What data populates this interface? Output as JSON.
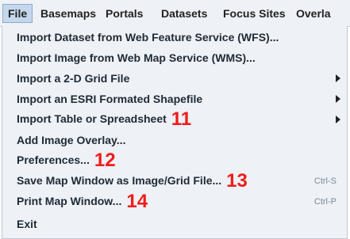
{
  "menubar": {
    "items": [
      {
        "label": "File",
        "active": true
      },
      {
        "label": "Basemaps"
      },
      {
        "label": "Portals"
      },
      {
        "label": "Datasets"
      },
      {
        "label": "Focus Sites"
      },
      {
        "label": "Overla"
      }
    ]
  },
  "file_menu": {
    "items": [
      {
        "label": "Import Dataset from Web Feature Service (WFS)..."
      },
      {
        "label": "Import Image from Web Map Service (WMS)..."
      },
      {
        "label": "Import a 2-D Grid File",
        "submenu": true
      },
      {
        "label": "Import an ESRI Formated Shapefile",
        "submenu": true
      },
      {
        "label": "Import Table or Spreadsheet",
        "submenu": true,
        "annotation": "11"
      },
      {
        "label": "Add Image Overlay..."
      },
      {
        "label": "Preferences...",
        "annotation": "12"
      },
      {
        "label": "Save Map Window as Image/Grid File...",
        "annotation": "13",
        "accelerator": "Ctrl-S"
      },
      {
        "label": "Print Map Window...",
        "annotation": "14",
        "accelerator": "Ctrl-P"
      },
      {
        "label": "Exit"
      }
    ]
  },
  "colors": {
    "menu_background": "#eef1f5",
    "active_menu_highlight": "#c5d7ec",
    "annotation_red": "#ee1c1c",
    "accelerator_gray": "#7a8a9a"
  }
}
